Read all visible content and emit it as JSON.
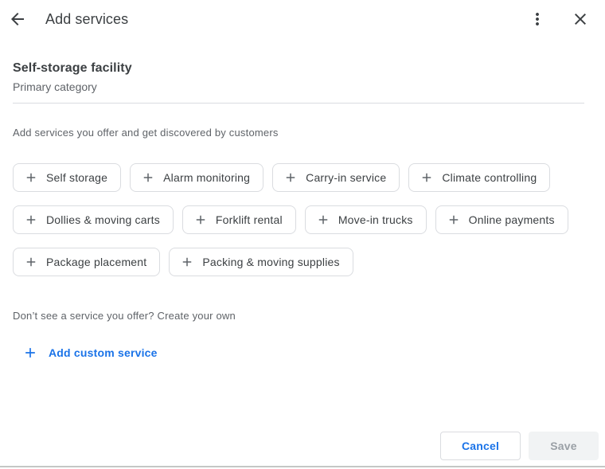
{
  "header": {
    "title": "Add services"
  },
  "icons": {
    "back": "arrow-left",
    "menu": "three-dot-vertical",
    "close": "x",
    "plus": "+"
  },
  "category": {
    "name": "Self-storage facility",
    "label": "Primary category"
  },
  "intro": "Add services you offer and get discovered by customers",
  "services": [
    "Self storage",
    "Alarm monitoring",
    "Carry-in service",
    "Climate controlling",
    "Dollies & moving carts",
    "Forklift rental",
    "Move-in trucks",
    "Online payments",
    "Package placement",
    "Packing & moving supplies"
  ],
  "custom": {
    "hint": "Don’t see a service you offer? Create your own",
    "link": "Add custom service"
  },
  "footer": {
    "cancel": "Cancel",
    "save": "Save"
  },
  "colors": {
    "accent": "#1a73e8",
    "text_primary": "#3c4043",
    "text_secondary": "#5f6368",
    "border": "#dadce0",
    "disabled_bg": "#f1f3f4",
    "disabled_text": "#9aa0a6"
  }
}
